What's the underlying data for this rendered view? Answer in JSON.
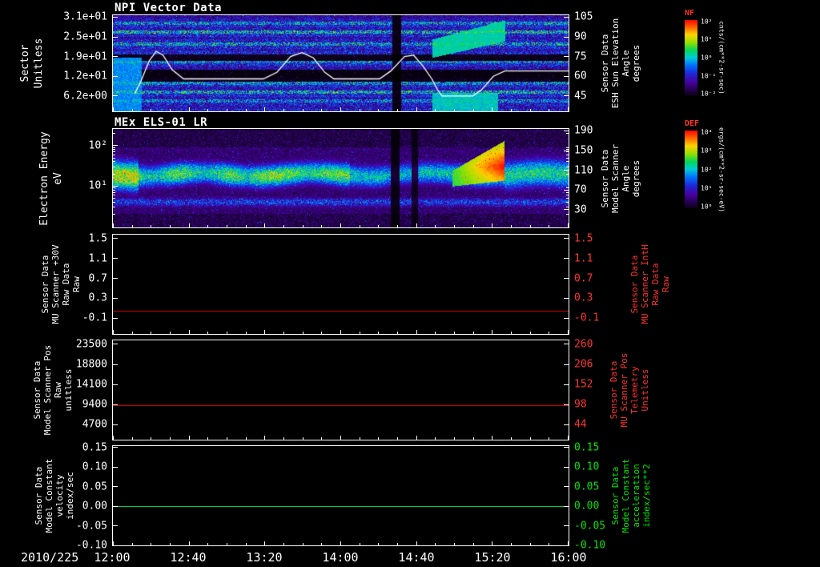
{
  "titles": {
    "panel1": "NPI Vector Data",
    "panel2": "MEx ELS-01 LR"
  },
  "x_axis": {
    "date": "2010/225",
    "ticks": [
      "12:00",
      "12:40",
      "13:20",
      "14:00",
      "14:40",
      "15:20",
      "16:00"
    ]
  },
  "colors": {
    "axis": "#ffffff",
    "red_label": "#ff3333",
    "green_label": "#00e500",
    "red_line": "#cc0000",
    "green_line": "#00cc44"
  },
  "panels": [
    {
      "name": "npi",
      "spectrogram": true,
      "left_label_lines": [
        "Sector",
        "Unitless"
      ],
      "left_tick_labels": [
        "3.1e+01",
        "2.5e+01",
        "1.9e+01",
        "1.2e+01",
        "6.2e+00"
      ],
      "right_tick_labels": [
        "105",
        "90",
        "75",
        "60",
        "45"
      ],
      "right_label_lines": [
        "Sensor Data",
        "ESH Sun Elevation",
        "Angle",
        "degrees"
      ],
      "right_color": "#ffffff"
    },
    {
      "name": "els",
      "spectrogram": true,
      "left_label_lines": [
        "Electron Energy",
        "eV"
      ],
      "left_tick_labels": [
        "10²",
        "10¹"
      ],
      "right_tick_labels": [
        "190",
        "150",
        "110",
        "70",
        "30"
      ],
      "right_label_lines": [
        "Sensor Data",
        "Model Scanner",
        "Angle",
        "degrees"
      ],
      "right_color": "#ffffff"
    },
    {
      "name": "mu-scanner-30v",
      "left_label_lines": [
        "Sensor Data",
        "MU Scanner +30V",
        "Raw Data",
        "Raw"
      ],
      "left_tick_labels": [
        "1.5",
        "1.1",
        "0.7",
        "0.3",
        "-0.1"
      ],
      "right_tick_labels": [
        "1.5",
        "1.1",
        "0.7",
        "0.3",
        "-0.1"
      ],
      "right_label_lines": [
        "Sensor Data",
        "MU Scanner IntH",
        "Raw Data",
        "Raw"
      ],
      "right_color": "#ff3333"
    },
    {
      "name": "model-scanner-pos",
      "left_label_lines": [
        "Sensor Data",
        "Model Scanner Pos",
        "Raw",
        "unitless"
      ],
      "left_tick_labels": [
        "23500",
        "18800",
        "14100",
        "9400",
        "4700"
      ],
      "right_tick_labels": [
        "260",
        "206",
        "152",
        "98",
        "44"
      ],
      "right_label_lines": [
        "Sensor Data",
        "MU Scanner Pos",
        "Telemetry",
        "Unitless"
      ],
      "right_color": "#ff3333"
    },
    {
      "name": "model-constant-velocity",
      "left_label_lines": [
        "Sensor Data",
        "Model Constant",
        "velocity",
        "index/sec"
      ],
      "left_tick_labels": [
        "0.15",
        "0.10",
        "0.05",
        "0.00",
        "-0.05",
        "-0.10"
      ],
      "right_tick_labels": [
        "0.15",
        "0.10",
        "0.05",
        "0.00",
        "-0.05",
        "-0.10"
      ],
      "right_label_lines": [
        "Sensor Data",
        "Model Constant",
        "acceleration",
        "index/sec**2"
      ],
      "right_color": "#00e500"
    }
  ],
  "colorbars": [
    {
      "title": "NF",
      "unit": "cnts/(cm**2-sr-sec)",
      "ticks": [
        "10²",
        "10¹",
        "10⁰",
        "10⁻¹",
        "10⁻²"
      ]
    },
    {
      "title": "DEF",
      "unit": "ergs/(cm**2-sr-sec-eV)",
      "ticks": [
        "10⁴",
        "10³",
        "10²",
        "10¹",
        "10⁰"
      ]
    }
  ],
  "chart_data": [
    {
      "type": "heatmap",
      "title": "NPI Vector Data",
      "ylabel": "Sector (Unitless)",
      "y_ticks": [
        "3.1e+01",
        "2.5e+01",
        "1.9e+01",
        "1.2e+01",
        "6.2e+00"
      ],
      "x_start": "2010/225 12:00",
      "x_end": "2010/225 16:00",
      "colorbar": {
        "name": "NF",
        "units": "cnts/(cm**2-sr-sec)",
        "ticks": [
          "10²",
          "10¹",
          "10⁰",
          "10⁻¹",
          "10⁻²"
        ]
      },
      "right_axis": {
        "label": "Sensor Data ESH Sun Elevation Angle (degrees)",
        "ticks": [
          105,
          90,
          75,
          60,
          45
        ]
      },
      "description": "32-sector count-rate spectrogram: dark purple/blue noise with brighter blue sector rows, black bands near sector rows 13-14 and 18-21, bright cyan patches 14:50-15:25 in upper and lower sectors, dark data-gap column near 14:30",
      "overlay": {
        "name": "ESH Sun Elevation Angle",
        "units": "degrees",
        "color": "#ffffff",
        "points_time_frac": [
          0.048,
          0.06,
          0.08,
          0.095,
          0.11,
          0.13,
          0.155,
          0.33,
          0.36,
          0.39,
          0.415,
          0.44,
          0.465,
          0.485,
          0.585,
          0.61,
          0.64,
          0.66,
          0.68,
          0.7,
          0.712,
          0.722,
          0.79,
          0.81,
          0.835,
          0.86,
          1.0
        ],
        "points_deg": [
          47,
          55,
          72,
          79,
          76,
          65,
          58,
          58,
          63,
          75,
          78,
          74,
          63,
          58,
          58,
          64,
          75,
          76,
          68,
          58,
          50,
          45,
          45,
          50,
          60,
          64,
          64
        ]
      }
    },
    {
      "type": "heatmap",
      "title": "MEx ELS-01 LR",
      "ylabel": "Electron Energy (eV)",
      "yscale": "log",
      "y_ticks": [
        "10²",
        "10¹"
      ],
      "colorbar": {
        "name": "DEF",
        "units": "ergs/(cm**2-sr-sec-eV)",
        "ticks": [
          "10⁴",
          "10³",
          "10²",
          "10¹",
          "10⁰"
        ]
      },
      "right_axis": {
        "label": "Sensor Data Model Scanner Angle (degrees)",
        "ticks": [
          190,
          150,
          110,
          70,
          30
        ]
      },
      "description": "Electron energy spectrogram: persistent green-yellow flux band near 10-30 eV across the whole interval, dark data-gap columns near 14:26 and 14:39, intense red-orange enhancement rising toward ~100 eV from 15:00-15:25, cyan-green band resuming after 15:25"
    },
    {
      "type": "line",
      "name": "Sensor Data MU Scanner +30V Raw Data (Raw)",
      "ylim": [
        -0.1,
        1.5
      ],
      "y_ticks": [
        1.5,
        1.1,
        0.7,
        0.3,
        -0.1
      ],
      "right_axis": {
        "label": "Sensor Data MU Scanner IntH Raw Data (Raw)",
        "ticks": [
          1.5,
          1.1,
          0.7,
          0.3,
          -0.1
        ]
      },
      "series": [
        {
          "name": "MU Scanner +30V",
          "color": "#cc0000",
          "constant_value": 0.05
        }
      ]
    },
    {
      "type": "line",
      "name": "Sensor Data Model Scanner Pos Raw (unitless)",
      "ylim": [
        4700,
        23500
      ],
      "y_ticks": [
        23500,
        18800,
        14100,
        9400,
        4700
      ],
      "right_axis": {
        "label": "Sensor Data MU Scanner Pos Telemetry (Unitless)",
        "ticks": [
          260,
          206,
          152,
          98,
          44
        ]
      },
      "series": [
        {
          "name": "Model Scanner Pos",
          "color": "#cc0000",
          "constant_value": 9300
        }
      ]
    },
    {
      "type": "line",
      "name": "Sensor Data Model Constant velocity (index/sec)",
      "ylim": [
        -0.1,
        0.15
      ],
      "y_ticks": [
        0.15,
        0.1,
        0.05,
        0.0,
        -0.05,
        -0.1
      ],
      "right_axis": {
        "label": "Sensor Data Model Constant acceleration (index/sec**2)",
        "ticks": [
          0.15,
          0.1,
          0.05,
          0.0,
          -0.05,
          -0.1
        ]
      },
      "series": [
        {
          "name": "Model Constant velocity",
          "color": "#00cc44",
          "constant_value": 0.0
        }
      ]
    }
  ]
}
